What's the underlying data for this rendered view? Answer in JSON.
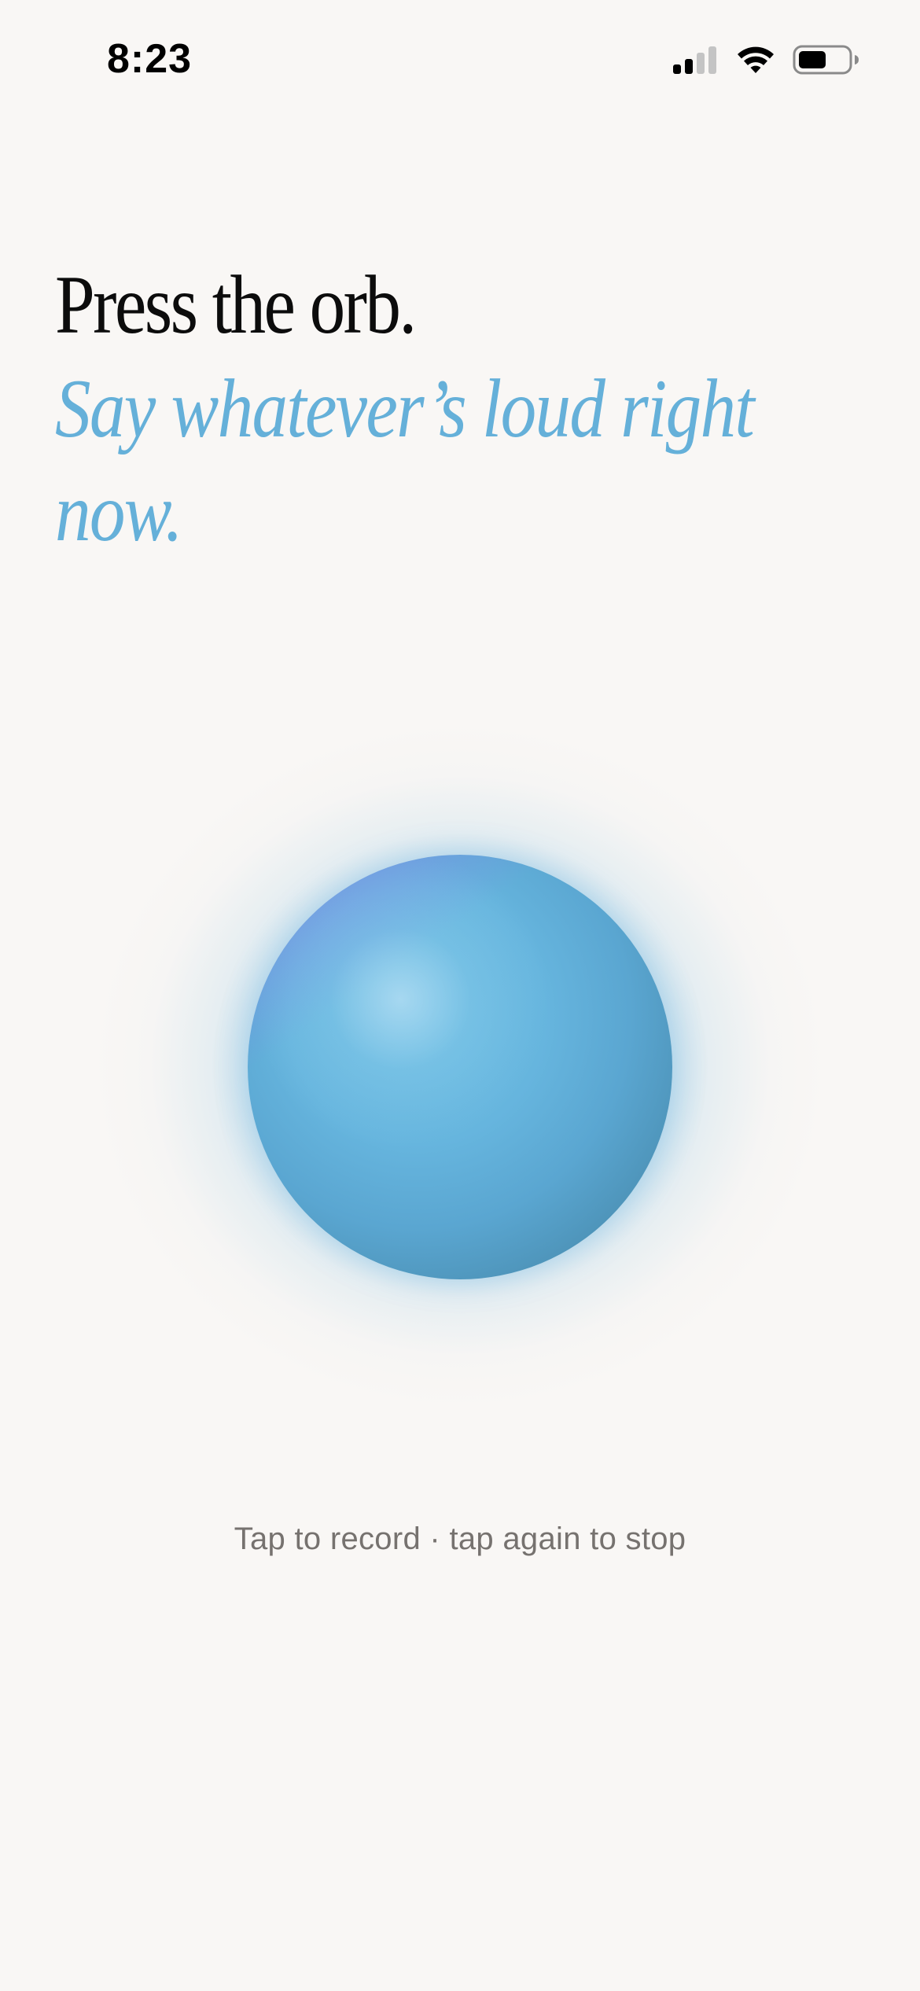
{
  "status_bar": {
    "time": "8:23",
    "icons": [
      "cellular-signal-icon",
      "wifi-icon",
      "battery-icon"
    ]
  },
  "heading": {
    "line1": "Press the orb.",
    "line2": "Say whatever’s loud right now."
  },
  "orb": {
    "icon": "record-orb"
  },
  "hint": {
    "text": "Tap to record · tap again to stop"
  },
  "colors": {
    "background": "#f9f7f5",
    "heading_primary": "#0c0c0c",
    "heading_accent": "#65b0d9",
    "orb": "#5aa6d1",
    "hint_text": "#76726f"
  }
}
